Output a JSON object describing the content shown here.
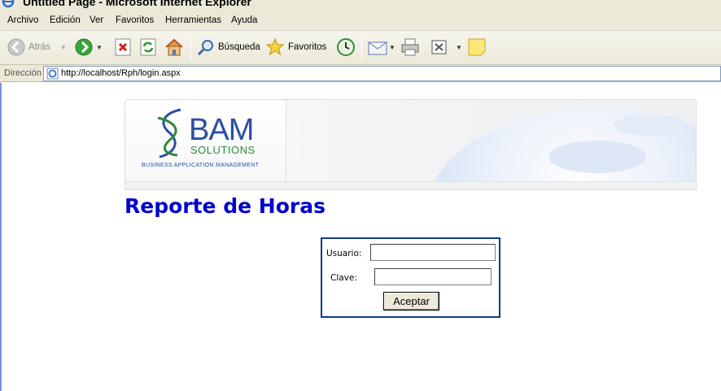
{
  "window": {
    "title": "Untitled Page - Microsoft Internet Explorer"
  },
  "menu": [
    "Archivo",
    "Edición",
    "Ver",
    "Favoritos",
    "Herramientas",
    "Ayuda"
  ],
  "toolbar": {
    "back_label": "Atrás",
    "search_label": "Búsqueda",
    "favorites_label": "Favoritos"
  },
  "address": {
    "label": "Dirección",
    "url": "http://localhost/Rph/login.aspx"
  },
  "banner": {
    "logo_main": "BAM",
    "logo_sub": "SOLUTIONS",
    "tagline": "BUSINESS APPLICATION MANAGEMENT",
    "colors": {
      "logo_blue": "#2a4fa0",
      "logo_green": "#2d8a3a"
    }
  },
  "page": {
    "title": "Reporte de Horas",
    "title_color": "#0000cc"
  },
  "login": {
    "user_label": "Usuario:",
    "user_value": "",
    "password_label": "Clave:",
    "password_value": "",
    "submit_label": "Aceptar",
    "border_color": "#0d3a8c"
  }
}
